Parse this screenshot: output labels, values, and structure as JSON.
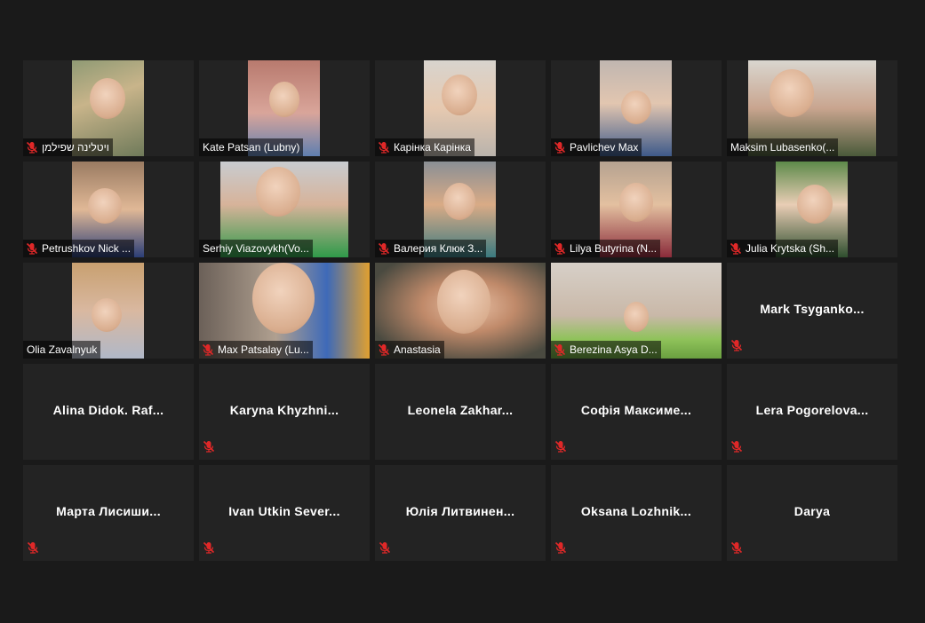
{
  "participants": [
    {
      "name": "ויטלינה שפילמן",
      "video": true,
      "muted": true,
      "rtl": true,
      "variant": "v0"
    },
    {
      "name": "Kate Patsan (Lubny)",
      "video": true,
      "muted": false,
      "variant": "v1"
    },
    {
      "name": "Карінка Карінка",
      "video": true,
      "muted": true,
      "variant": "v2"
    },
    {
      "name": "Pavlichev Max",
      "video": true,
      "muted": true,
      "variant": "v3"
    },
    {
      "name": "Maksim Lubasenko(...",
      "video": true,
      "muted": false,
      "variant": "v4"
    },
    {
      "name": "Petrushkov Nick ...",
      "video": true,
      "muted": true,
      "variant": "v5"
    },
    {
      "name": "Serhiy Viazovykh(Vo...",
      "video": true,
      "muted": false,
      "variant": "v6"
    },
    {
      "name": "Валерия Клюк З...",
      "video": true,
      "muted": true,
      "variant": "v7"
    },
    {
      "name": "Lilya Butyrina (N...",
      "video": true,
      "muted": true,
      "variant": "v8"
    },
    {
      "name": "Julia Krytska (Sh...",
      "video": true,
      "muted": true,
      "variant": "v9"
    },
    {
      "name": "Olia Zavalnyuk",
      "video": true,
      "muted": false,
      "variant": "v10"
    },
    {
      "name": "Max Patsalay (Lu...",
      "video": true,
      "muted": true,
      "variant": "v11"
    },
    {
      "name": "Anastasia",
      "video": true,
      "muted": true,
      "variant": "v12"
    },
    {
      "name": "Berezina Asya D...",
      "video": true,
      "muted": true,
      "variant": "v13"
    },
    {
      "name": "Mark  Tsyganko...",
      "video": false,
      "muted": true
    },
    {
      "name": "Alina  Didok.  Raf...",
      "video": false,
      "muted": false
    },
    {
      "name": "Karyna  Khyzhni...",
      "video": false,
      "muted": true
    },
    {
      "name": "Leonela  Zakhar...",
      "video": false,
      "muted": false
    },
    {
      "name": "Софія  Максиме...",
      "video": false,
      "muted": true
    },
    {
      "name": "Lera  Pogorelova...",
      "video": false,
      "muted": true
    },
    {
      "name": "Марта  Лисиши...",
      "video": false,
      "muted": true
    },
    {
      "name": "Ivan  Utkin  Sever...",
      "video": false,
      "muted": true
    },
    {
      "name": "Юлія  Литвинен...",
      "video": false,
      "muted": true
    },
    {
      "name": "Oksana  Lozhnik...",
      "video": false,
      "muted": true
    },
    {
      "name": "Darya",
      "video": false,
      "muted": true
    }
  ],
  "colors": {
    "background": "#1a1a1a",
    "tile": "#232323",
    "mute_icon": "#e02828",
    "text": "#ffffff"
  },
  "icons": {
    "mute": "mic-muted-icon"
  }
}
